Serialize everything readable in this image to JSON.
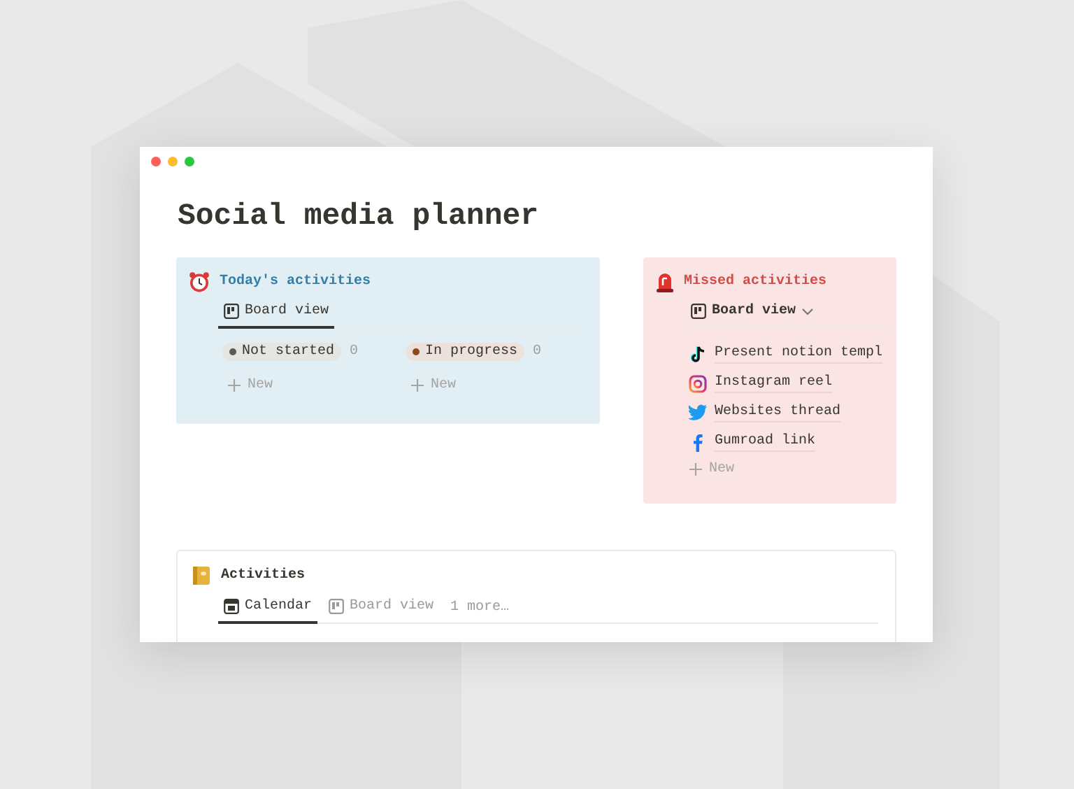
{
  "title": "Social media planner",
  "today": {
    "heading": "Today's activities",
    "tabs": [
      {
        "label": "Board view",
        "selected": true
      }
    ],
    "groups": [
      {
        "label": "Not started",
        "count": "0",
        "color": "#5a5a57",
        "new": "New"
      },
      {
        "label": "In progress",
        "count": "0",
        "color": "#8c4a1c",
        "new": "New"
      }
    ]
  },
  "missed": {
    "heading": "Missed activities",
    "tabs": [
      {
        "label": "Board view",
        "selected": true
      }
    ],
    "items": [
      {
        "kind": "tiktok",
        "label": "Present notion templ"
      },
      {
        "kind": "instagram",
        "label": "Instagram reel"
      },
      {
        "kind": "twitter",
        "label": "Websites thread"
      },
      {
        "kind": "facebook",
        "label": "Gumroad link"
      }
    ],
    "new": "New"
  },
  "activities": {
    "heading": "Activities",
    "tabs": [
      {
        "kind": "calendar",
        "label": "Calendar",
        "selected": true
      },
      {
        "kind": "board",
        "label": "Board view",
        "selected": false
      }
    ],
    "more": "1 more…"
  }
}
